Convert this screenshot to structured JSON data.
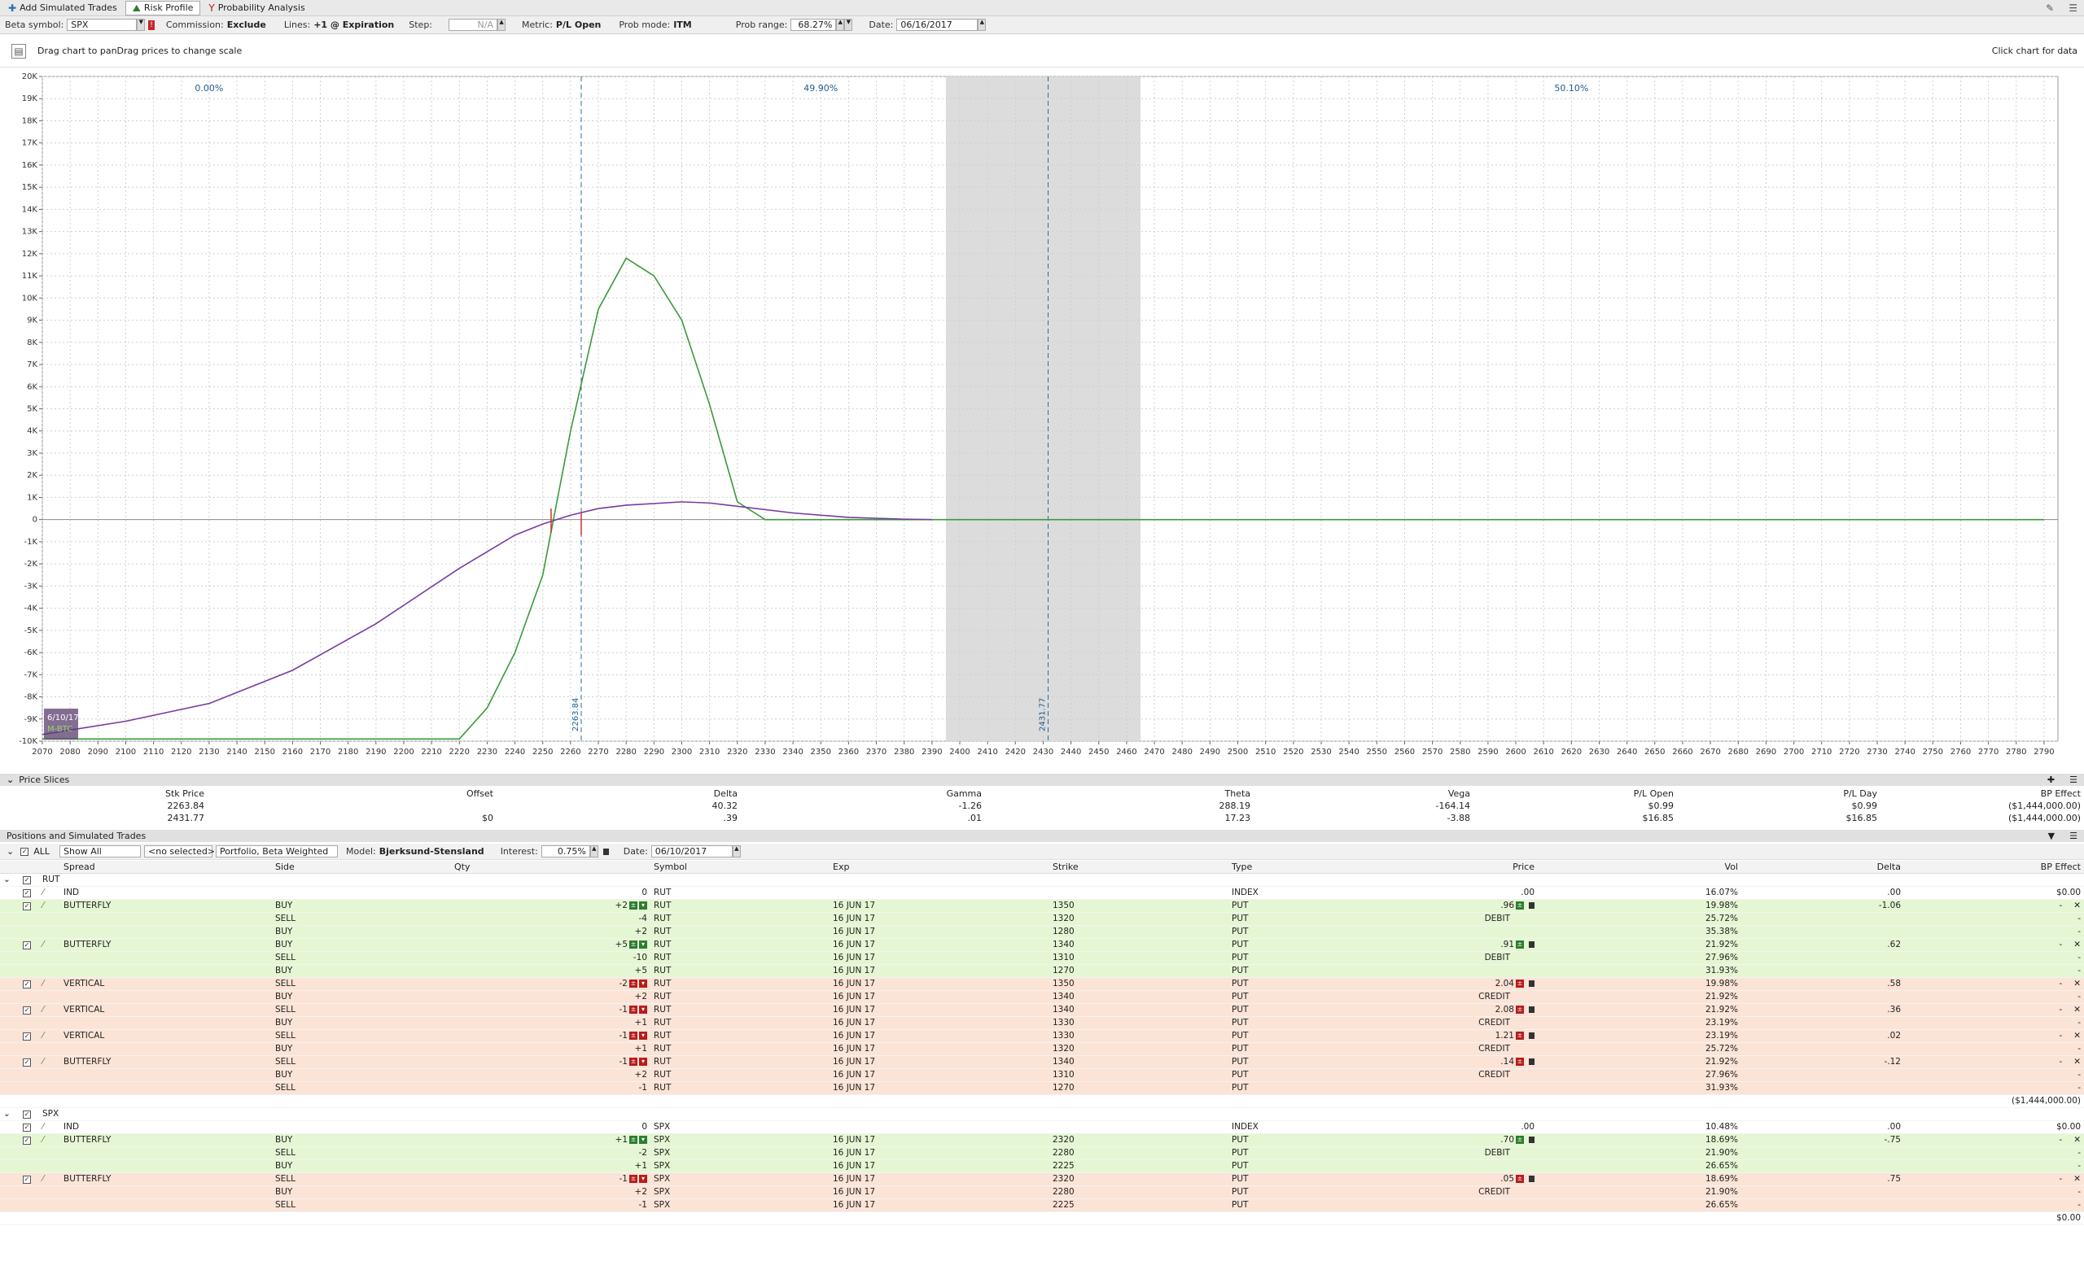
{
  "toolbar": {
    "add_simulated": "Add Simulated Trades",
    "risk_profile": "Risk Profile",
    "prob_analysis": "Probability Analysis"
  },
  "settings": {
    "beta_symbol_label": "Beta symbol:",
    "beta_symbol": "SPX",
    "commission_label": "Commission:",
    "commission": "Exclude",
    "lines_label": "Lines:",
    "lines": "+1 @ Expiration",
    "step_label": "Step:",
    "step": "N/A",
    "metric_label": "Metric:",
    "metric": "P/L Open",
    "prob_mode_label": "Prob mode:",
    "prob_mode": "ITM",
    "prob_range_label": "Prob range:",
    "prob_range": "68.27%",
    "date_label": "Date:",
    "date": "06/16/2017"
  },
  "chart_header": {
    "left": "Drag chart to panDrag prices to change scale",
    "right": "Click chart for data"
  },
  "chart_data": {
    "type": "line",
    "xlim": [
      2070,
      2795
    ],
    "ylim": [
      -10000,
      20000
    ],
    "x_ticks": [
      2070,
      2080,
      2090,
      2100,
      2110,
      2120,
      2130,
      2140,
      2150,
      2160,
      2170,
      2180,
      2190,
      2200,
      2210,
      2220,
      2230,
      2240,
      2250,
      2260,
      2270,
      2280,
      2290,
      2300,
      2310,
      2320,
      2330,
      2340,
      2350,
      2360,
      2370,
      2380,
      2390,
      2400,
      2410,
      2420,
      2430,
      2440,
      2450,
      2460,
      2470,
      2480,
      2490,
      2500,
      2510,
      2520,
      2530,
      2540,
      2550,
      2560,
      2570,
      2580,
      2590,
      2600,
      2610,
      2620,
      2630,
      2640,
      2650,
      2660,
      2670,
      2680,
      2690,
      2700,
      2710,
      2720,
      2730,
      2740,
      2750,
      2760,
      2770,
      2780,
      2790
    ],
    "y_ticks": [
      20000,
      19000,
      18000,
      17000,
      16000,
      15000,
      14000,
      13000,
      12000,
      11000,
      10000,
      9000,
      8000,
      7000,
      6000,
      5000,
      4000,
      3000,
      2000,
      1000,
      0,
      -1000,
      -2000,
      -3000,
      -4000,
      -5000,
      -6000,
      -7000,
      -8000,
      -9000,
      -10000
    ],
    "y_tick_labels": [
      "20K",
      "19K",
      "18K",
      "17K",
      "16K",
      "15K",
      "14K",
      "13K",
      "12K",
      "11K",
      "10K",
      "9K",
      "8K",
      "7K",
      "6K",
      "5K",
      "4K",
      "3K",
      "2K",
      "1K",
      "0",
      "-1K",
      "-2K",
      "-3K",
      "-4K",
      "-5K",
      "-6K",
      "-7K",
      "-8K",
      "-9K",
      "-10K"
    ],
    "series": [
      {
        "color": "#3a9a3a",
        "x": [
          2070,
          2200,
          2220,
          2230,
          2240,
          2250,
          2260,
          2270,
          2280,
          2290,
          2300,
          2310,
          2320,
          2330,
          2340,
          2400,
          2500,
          2790
        ],
        "y": [
          -9900,
          -9900,
          -9900,
          -8500,
          -6000,
          -2500,
          4000,
          9500,
          11800,
          11000,
          9000,
          5200,
          800,
          0,
          0,
          0,
          0,
          0
        ]
      },
      {
        "color": "#7a3aa0",
        "x": [
          2070,
          2100,
          2130,
          2160,
          2190,
          2220,
          2240,
          2250,
          2260,
          2270,
          2280,
          2300,
          2310,
          2320,
          2340,
          2360,
          2380,
          2390
        ],
        "y": [
          -9700,
          -9100,
          -8300,
          -6800,
          -4700,
          -2200,
          -700,
          -200,
          200,
          500,
          650,
          800,
          750,
          600,
          300,
          100,
          20,
          0
        ]
      }
    ],
    "prob_labels": [
      {
        "x": 2130,
        "text": "0.00%"
      },
      {
        "x": 2350,
        "text": "49.90%"
      },
      {
        "x": 2620,
        "text": "50.10%"
      }
    ],
    "shaded_range": [
      2395,
      2465
    ],
    "markers": [
      {
        "x": 2263.84,
        "label": "2263.84"
      },
      {
        "x": 2431.77,
        "label": "2431.77"
      }
    ],
    "badge": {
      "lines": [
        "6/10/17",
        "M-BTC"
      ]
    }
  },
  "price_slices": {
    "title": "Price Slices",
    "headers": [
      "Stk Price",
      "Offset",
      "Delta",
      "Gamma",
      "Theta",
      "Vega",
      "P/L Open",
      "P/L Day",
      "BP Effect"
    ],
    "rows": [
      [
        "2263.84",
        "",
        "40.32",
        "-1.26",
        "288.19",
        "-164.14",
        "$0.99",
        "$0.99",
        "($1,444,000.00)"
      ],
      [
        "2431.77",
        "$0",
        ".39",
        ".01",
        "17.23",
        "-3.88",
        "$16.85",
        "$16.85",
        "($1,444,000.00)"
      ]
    ]
  },
  "positions": {
    "title": "Positions and Simulated Trades",
    "ctrl": {
      "all": "ALL",
      "show": "Show All",
      "selected": "<no selected>",
      "portfolio": "Portfolio, Beta Weighted",
      "model_label": "Model:",
      "model": "Bjerksund-Stensland",
      "interest_label": "Interest:",
      "interest": "0.75%",
      "date_label": "Date:",
      "date": "06/10/2017"
    },
    "headers": [
      "Spread",
      "Side",
      "Qty",
      "Symbol",
      "Exp",
      "Strike",
      "Type",
      "Price",
      "Vol",
      "Delta",
      "BP Effect"
    ],
    "groups": [
      {
        "name": "RUT",
        "total": "($1,444,000.00)",
        "rows": [
          {
            "c": "w",
            "spread": "IND",
            "side": "",
            "qty": "0",
            "sym": "RUT",
            "exp": "",
            "strike": "",
            "type": "INDEX",
            "price": ".00",
            "pnote": "",
            "vol": "16.07%",
            "delta": ".00",
            "bp": "$0.00"
          },
          {
            "c": "gh",
            "spread": "BUTTERFLY",
            "side": "BUY",
            "qty": "+2",
            "sym": "RUT",
            "exp": "16 JUN 17",
            "strike": "1350",
            "type": "PUT",
            "price": ".96",
            "pnote": "",
            "vol": "19.98%",
            "delta": "-1.06",
            "bp": "-"
          },
          {
            "c": "g",
            "spread": "",
            "side": "SELL",
            "qty": "-4",
            "sym": "RUT",
            "exp": "16 JUN 17",
            "strike": "1320",
            "type": "PUT",
            "price": "",
            "pnote": "DEBIT",
            "vol": "25.72%",
            "delta": "",
            "bp": "-"
          },
          {
            "c": "g",
            "spread": "",
            "side": "BUY",
            "qty": "+2",
            "sym": "RUT",
            "exp": "16 JUN 17",
            "strike": "1280",
            "type": "PUT",
            "price": "",
            "pnote": "",
            "vol": "35.38%",
            "delta": "",
            "bp": "-"
          },
          {
            "c": "gh",
            "spread": "BUTTERFLY",
            "side": "BUY",
            "qty": "+5",
            "sym": "RUT",
            "exp": "16 JUN 17",
            "strike": "1340",
            "type": "PUT",
            "price": ".91",
            "pnote": "",
            "vol": "21.92%",
            "delta": ".62",
            "bp": "-"
          },
          {
            "c": "g",
            "spread": "",
            "side": "SELL",
            "qty": "-10",
            "sym": "RUT",
            "exp": "16 JUN 17",
            "strike": "1310",
            "type": "PUT",
            "price": "",
            "pnote": "DEBIT",
            "vol": "27.96%",
            "delta": "",
            "bp": "-"
          },
          {
            "c": "g",
            "spread": "",
            "side": "BUY",
            "qty": "+5",
            "sym": "RUT",
            "exp": "16 JUN 17",
            "strike": "1270",
            "type": "PUT",
            "price": "",
            "pnote": "",
            "vol": "31.93%",
            "delta": "",
            "bp": "-"
          },
          {
            "c": "rh",
            "spread": "VERTICAL",
            "side": "SELL",
            "qty": "-2",
            "sym": "RUT",
            "exp": "16 JUN 17",
            "strike": "1350",
            "type": "PUT",
            "price": "2.04",
            "pnote": "",
            "vol": "19.98%",
            "delta": ".58",
            "bp": "-"
          },
          {
            "c": "r",
            "spread": "",
            "side": "BUY",
            "qty": "+2",
            "sym": "RUT",
            "exp": "16 JUN 17",
            "strike": "1340",
            "type": "PUT",
            "price": "",
            "pnote": "CREDIT",
            "vol": "21.92%",
            "delta": "",
            "bp": "-"
          },
          {
            "c": "rh",
            "spread": "VERTICAL",
            "side": "SELL",
            "qty": "-1",
            "sym": "RUT",
            "exp": "16 JUN 17",
            "strike": "1340",
            "type": "PUT",
            "price": "2.08",
            "pnote": "",
            "vol": "21.92%",
            "delta": ".36",
            "bp": "-"
          },
          {
            "c": "r",
            "spread": "",
            "side": "BUY",
            "qty": "+1",
            "sym": "RUT",
            "exp": "16 JUN 17",
            "strike": "1330",
            "type": "PUT",
            "price": "",
            "pnote": "CREDIT",
            "vol": "23.19%",
            "delta": "",
            "bp": "-"
          },
          {
            "c": "rh",
            "spread": "VERTICAL",
            "side": "SELL",
            "qty": "-1",
            "sym": "RUT",
            "exp": "16 JUN 17",
            "strike": "1330",
            "type": "PUT",
            "price": "1.21",
            "pnote": "",
            "vol": "23.19%",
            "delta": ".02",
            "bp": "-"
          },
          {
            "c": "r",
            "spread": "",
            "side": "BUY",
            "qty": "+1",
            "sym": "RUT",
            "exp": "16 JUN 17",
            "strike": "1320",
            "type": "PUT",
            "price": "",
            "pnote": "CREDIT",
            "vol": "25.72%",
            "delta": "",
            "bp": "-"
          },
          {
            "c": "rh",
            "spread": "BUTTERFLY",
            "side": "SELL",
            "qty": "-1",
            "sym": "RUT",
            "exp": "16 JUN 17",
            "strike": "1340",
            "type": "PUT",
            "price": ".14",
            "pnote": "",
            "vol": "21.92%",
            "delta": "-.12",
            "bp": "-"
          },
          {
            "c": "r",
            "spread": "",
            "side": "BUY",
            "qty": "+2",
            "sym": "RUT",
            "exp": "16 JUN 17",
            "strike": "1310",
            "type": "PUT",
            "price": "",
            "pnote": "CREDIT",
            "vol": "27.96%",
            "delta": "",
            "bp": "-"
          },
          {
            "c": "r",
            "spread": "",
            "side": "SELL",
            "qty": "-1",
            "sym": "RUT",
            "exp": "16 JUN 17",
            "strike": "1270",
            "type": "PUT",
            "price": "",
            "pnote": "",
            "vol": "31.93%",
            "delta": "",
            "bp": "-"
          }
        ]
      },
      {
        "name": "SPX",
        "total": "$0.00",
        "rows": [
          {
            "c": "w",
            "spread": "IND",
            "side": "",
            "qty": "0",
            "sym": "SPX",
            "exp": "",
            "strike": "",
            "type": "INDEX",
            "price": ".00",
            "pnote": "",
            "vol": "10.48%",
            "delta": ".00",
            "bp": "$0.00"
          },
          {
            "c": "gh",
            "spread": "BUTTERFLY",
            "side": "BUY",
            "qty": "+1",
            "sym": "SPX",
            "exp": "16 JUN 17",
            "strike": "2320",
            "type": "PUT",
            "price": ".70",
            "pnote": "",
            "vol": "18.69%",
            "delta": "-.75",
            "bp": "-"
          },
          {
            "c": "g",
            "spread": "",
            "side": "SELL",
            "qty": "-2",
            "sym": "SPX",
            "exp": "16 JUN 17",
            "strike": "2280",
            "type": "PUT",
            "price": "",
            "pnote": "DEBIT",
            "vol": "21.90%",
            "delta": "",
            "bp": "-"
          },
          {
            "c": "g",
            "spread": "",
            "side": "BUY",
            "qty": "+1",
            "sym": "SPX",
            "exp": "16 JUN 17",
            "strike": "2225",
            "type": "PUT",
            "price": "",
            "pnote": "",
            "vol": "26.65%",
            "delta": "",
            "bp": "-"
          },
          {
            "c": "rh",
            "spread": "BUTTERFLY",
            "side": "SELL",
            "qty": "-1",
            "sym": "SPX",
            "exp": "16 JUN 17",
            "strike": "2320",
            "type": "PUT",
            "price": ".05",
            "pnote": "",
            "vol": "18.69%",
            "delta": ".75",
            "bp": "-"
          },
          {
            "c": "r",
            "spread": "",
            "side": "BUY",
            "qty": "+2",
            "sym": "SPX",
            "exp": "16 JUN 17",
            "strike": "2280",
            "type": "PUT",
            "price": "",
            "pnote": "CREDIT",
            "vol": "21.90%",
            "delta": "",
            "bp": "-"
          },
          {
            "c": "r",
            "spread": "",
            "side": "SELL",
            "qty": "-1",
            "sym": "SPX",
            "exp": "16 JUN 17",
            "strike": "2225",
            "type": "PUT",
            "price": "",
            "pnote": "",
            "vol": "26.65%",
            "delta": "",
            "bp": "-"
          }
        ]
      }
    ]
  }
}
